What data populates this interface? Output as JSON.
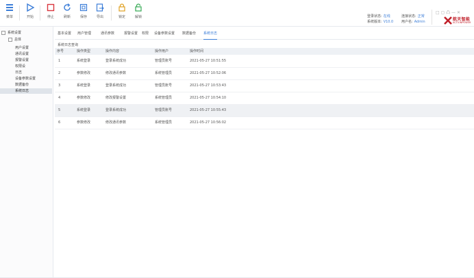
{
  "toolbar": {
    "items": [
      {
        "label": "菜单",
        "icon": "menu-icon"
      },
      {
        "label": "开始",
        "icon": "play-icon"
      },
      {
        "label": "停止",
        "icon": "stop-icon"
      },
      {
        "label": "刷新",
        "icon": "refresh-icon"
      },
      {
        "label": "保存",
        "icon": "save-icon"
      },
      {
        "label": "导出",
        "icon": "export-icon"
      },
      {
        "label": "锁定",
        "icon": "lock-icon"
      },
      {
        "label": "解锁",
        "icon": "unlock-icon"
      }
    ],
    "info": {
      "line1_key": "登录状态:",
      "line1_val": "在线",
      "line2_key": "连接状态:",
      "line2_val": "正常",
      "line3_key": "系统版本:",
      "line3_val": "V10.0",
      "line4_key": "用户名:",
      "line4_val": "Admin"
    },
    "window_controls": "□ ▢ 凸 — ✕",
    "logo": {
      "text": "航天智能",
      "sub": "ACTIONPOWER"
    }
  },
  "colors": {
    "accent": "#3b7dd8",
    "brand": "#c0202a"
  },
  "sidebar": {
    "root": "系统设置",
    "items": [
      {
        "label": "总体",
        "indent": 1
      },
      {
        "label": "用户设置",
        "indent": 2
      },
      {
        "label": "通讯设置",
        "indent": 2
      },
      {
        "label": "报警设置",
        "indent": 2
      },
      {
        "label": "权限设",
        "indent": 2
      },
      {
        "label": "日志",
        "indent": 2
      },
      {
        "label": "设备参数设置",
        "indent": 2
      },
      {
        "label": "数据备份",
        "indent": 2
      },
      {
        "label": "系统日志",
        "indent": 2,
        "active": true
      }
    ]
  },
  "tabs": [
    {
      "label": "基本设置"
    },
    {
      "label": "用户管理"
    },
    {
      "label": "通讯参数"
    },
    {
      "label": "报警设置"
    },
    {
      "label": "权限"
    },
    {
      "label": "设备参数设置"
    },
    {
      "label": "数据备份"
    },
    {
      "label": "系统日志",
      "active": true
    }
  ],
  "section_title": "系统日志查询",
  "table": {
    "columns": [
      "序号",
      "操作类型",
      "操作内容",
      "操作用户",
      "操作时间"
    ],
    "rows": [
      [
        "1",
        "系统登录",
        "登录系统成功",
        "管理员账号",
        "2021-05-27 10:51:55"
      ],
      [
        "2",
        "参数修改",
        "修改通讯参数",
        "系统管理员",
        "2021-05-27 10:52:06"
      ],
      [
        "3",
        "系统登录",
        "登录系统成功",
        "管理员账号",
        "2021-05-27 10:53:43"
      ],
      [
        "4",
        "参数修改",
        "修改报警设置",
        "系统管理员",
        "2021-05-27 10:54:10"
      ],
      [
        "5",
        "系统登录",
        "登录系统成功",
        "管理员账号",
        "2021-05-27 10:55:43"
      ],
      [
        "6",
        "参数修改",
        "修改通讯参数",
        "系统管理员",
        "2021-05-27 10:56:02"
      ]
    ],
    "selected_row": 4
  }
}
